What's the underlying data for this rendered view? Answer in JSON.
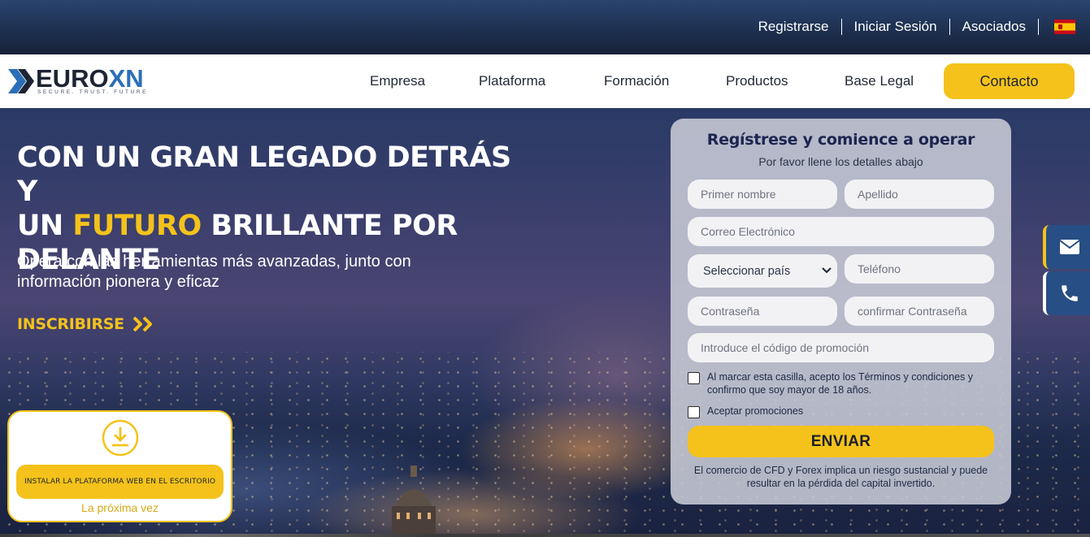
{
  "top_nav": {
    "register": "Registrarse",
    "login": "Iniciar Sesión",
    "partners": "Asociados",
    "language_icon": "spain-flag-icon"
  },
  "brand": {
    "name_part1": "EURO",
    "name_part2": "XN",
    "tagline": "SECURE. TRUST. FUTURE",
    "accent_color": "#2a6fb8"
  },
  "main_nav": {
    "items": [
      "Empresa",
      "Plataforma",
      "Formación",
      "Productos",
      "Base Legal"
    ],
    "contact_label": "Contacto"
  },
  "hero": {
    "title_line1": "CON UN GRAN LEGADO DETRÁS Y",
    "title_line2_pre": "UN ",
    "title_line2_highlight": "FUTURO",
    "title_line2_post": " BRILLANTE POR",
    "title_line3": "DELANTE",
    "subtitle": "Opera con las herramientas más avanzadas, junto con información pionera y eficaz",
    "cta_label": "INSCRIBIRSE",
    "cta_icon": "double-chevron-right-icon"
  },
  "install_card": {
    "icon": "download-icon",
    "button_label": "INSTALAR LA PLATAFORMA WEB EN EL ESCRITORIO",
    "later_label": "La próxima vez"
  },
  "form": {
    "title": "Regístrese y comience a operar",
    "subtitle": "Por favor llene los detalles abajo",
    "first_name_placeholder": "Primer nombre",
    "last_name_placeholder": "Apellido",
    "email_placeholder": "Correo Electrónico",
    "country_selected": "Seleccionar país",
    "phone_placeholder": "Teléfono",
    "password_placeholder": "Contraseña",
    "confirm_password_placeholder": "confirmar Contraseña",
    "promo_placeholder": "Introduce el código de promoción",
    "terms_label": "Al marcar esta casilla, acepto los Términos y condiciones y confirmo que soy mayor de 18 años.",
    "promotions_label": "Aceptar promociones",
    "submit_label": "ENVIAR",
    "disclaimer": "El comercio de CFD y Forex implica un riesgo sustancial y puede resultar en la pérdida del capital invertido."
  },
  "side_contacts": {
    "mail_icon": "envelope-icon",
    "phone_icon": "phone-icon"
  },
  "colors": {
    "brand_yellow": "#f4c21b",
    "navy": "#1b2550",
    "side_blue": "#274e85"
  }
}
